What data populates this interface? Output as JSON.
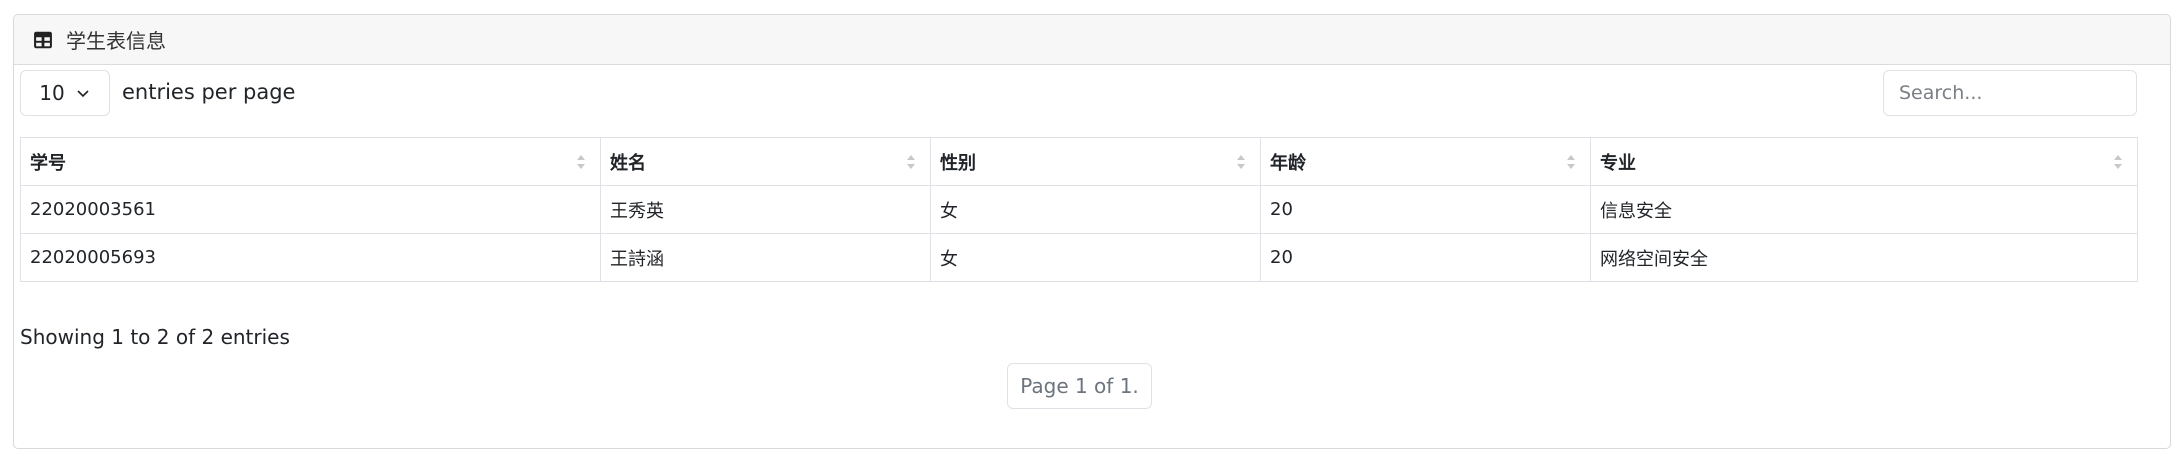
{
  "card": {
    "title": "学生表信息",
    "icon": "table-icon"
  },
  "controls": {
    "per_page_value": "10",
    "per_page_label": "entries per page",
    "search_placeholder": "Search..."
  },
  "table": {
    "headers": [
      "学号",
      "姓名",
      "性别",
      "年龄",
      "专业"
    ],
    "rows": [
      [
        "22020003561",
        "王秀英",
        "女",
        "20",
        "信息安全"
      ],
      [
        "22020005693",
        "王詩涵",
        "女",
        "20",
        "网络空间安全"
      ]
    ]
  },
  "footer": {
    "summary": "Showing 1 to 2 of 2 entries",
    "pagination": "Page 1 of 1."
  }
}
